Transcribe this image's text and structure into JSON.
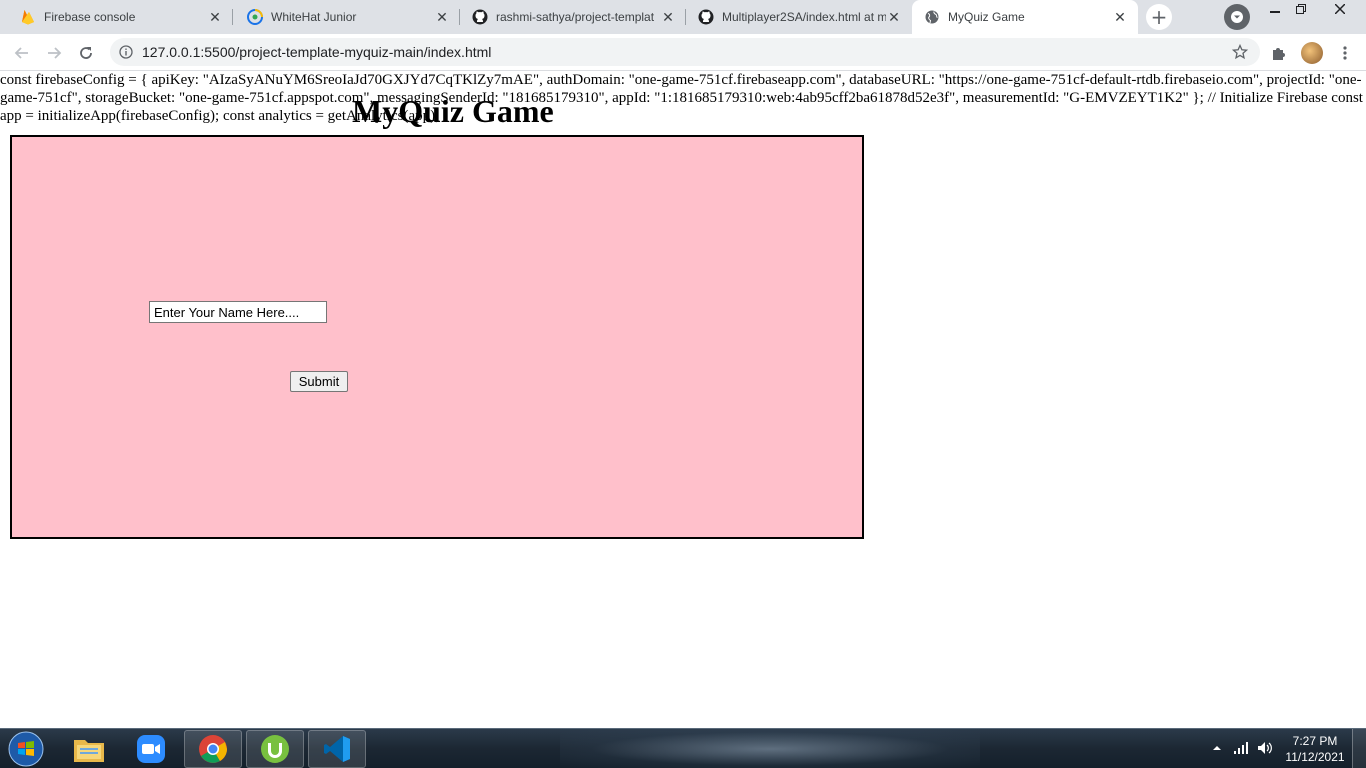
{
  "browser": {
    "tabs": [
      {
        "title": "Firebase console",
        "icon": "firebase-icon"
      },
      {
        "title": "WhiteHat Junior",
        "icon": "whitehat-icon"
      },
      {
        "title": "rashmi-sathya/project-templat",
        "icon": "github-icon"
      },
      {
        "title": "Multiplayer2SA/index.html at m",
        "icon": "github-icon"
      },
      {
        "title": "MyQuiz Game",
        "icon": "globe-icon",
        "active": true
      }
    ],
    "new_tab_label": "+",
    "url": "127.0.0.1:5500/project-template-myquiz-main/index.html"
  },
  "page": {
    "config_text": "const firebaseConfig = { apiKey: \"AIzaSyANuYM6SreoIaJd70GXJYd7CqTKlZy7mAE\", authDomain: \"one-game-751cf.firebaseapp.com\", databaseURL: \"https://one-game-751cf-default-rtdb.firebaseio.com\", projectId: \"one-game-751cf\", storageBucket: \"one-game-751cf.appspot.com\", messagingSenderId: \"181685179310\", appId: \"1:181685179310:web:4ab95cff2ba61878d52e3f\", measurementId: \"G-EMVZEYT1K2\" }; // Initialize Firebase const app = initializeApp(firebaseConfig); const analytics = getAnalytics(app);",
    "title": "MyQuiz Game",
    "canvas_color": "#ffc0cb",
    "name_input": {
      "placeholder": "Enter Your Name Here....",
      "value": ""
    },
    "submit_label": "Submit"
  },
  "taskbar": {
    "items": [
      "start-button",
      "file-explorer-icon",
      "zoom-icon",
      "chrome-icon",
      "utorrent-icon",
      "vscode-icon"
    ],
    "clock": {
      "time": "7:27 PM",
      "date": "11/12/2021"
    }
  }
}
